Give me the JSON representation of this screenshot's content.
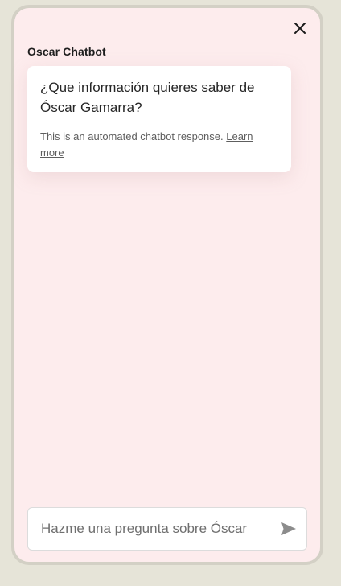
{
  "chatbot": {
    "title": "Oscar Chatbot",
    "close_icon": "close-icon"
  },
  "messages": [
    {
      "text": "¿Que información quieres saber de Óscar Gamarra?",
      "disclaimer": "This is an automated chatbot response.",
      "learn_more": "Learn more"
    }
  ],
  "composer": {
    "placeholder": "Hazme una pregunta sobre Óscar",
    "value": "",
    "send_icon": "send-icon"
  },
  "colors": {
    "page_background": "#e6e4d8",
    "window_background": "#fdeced",
    "window_border": "#d3d0c5",
    "card_background": "#ffffff"
  }
}
